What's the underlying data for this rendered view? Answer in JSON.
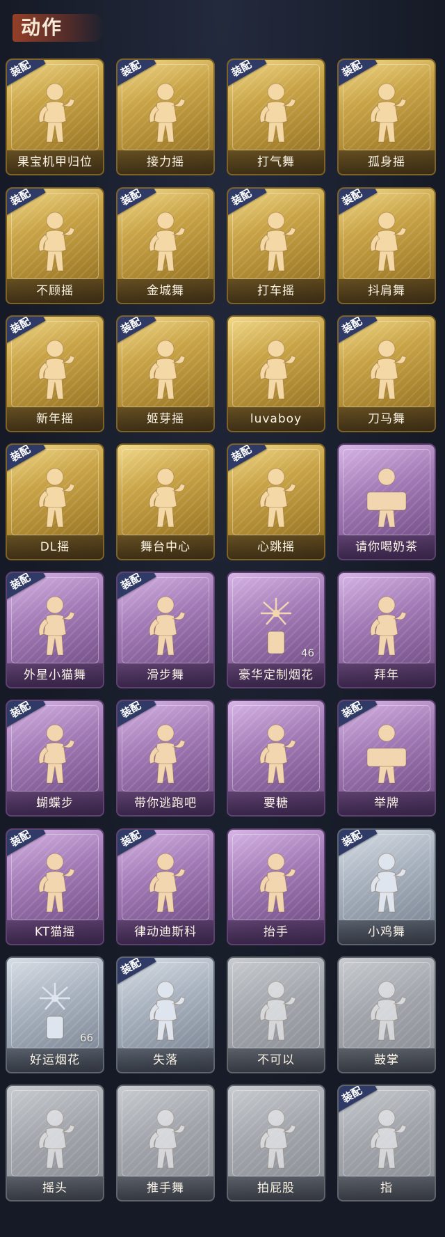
{
  "header": {
    "title": "动作"
  },
  "badge_label": "装配",
  "cards": [
    {
      "label": "果宝机甲归位",
      "tier": "gold",
      "equipped": true,
      "count": "",
      "icon": "dance-pose-icon"
    },
    {
      "label": "接力摇",
      "tier": "gold",
      "equipped": true,
      "count": "",
      "icon": "dance-pose-icon"
    },
    {
      "label": "打气舞",
      "tier": "gold",
      "equipped": true,
      "count": "",
      "icon": "dance-pose-icon"
    },
    {
      "label": "孤身摇",
      "tier": "gold",
      "equipped": true,
      "count": "",
      "icon": "dance-pose-icon"
    },
    {
      "label": "不顾摇",
      "tier": "gold",
      "equipped": true,
      "count": "",
      "icon": "dance-pose-icon"
    },
    {
      "label": "金城舞",
      "tier": "gold",
      "equipped": true,
      "count": "",
      "icon": "dance-pose-icon"
    },
    {
      "label": "打车摇",
      "tier": "gold",
      "equipped": true,
      "count": "",
      "icon": "dance-pose-icon"
    },
    {
      "label": "抖肩舞",
      "tier": "gold",
      "equipped": true,
      "count": "",
      "icon": "dance-pose-icon"
    },
    {
      "label": "新年摇",
      "tier": "gold",
      "equipped": true,
      "count": "",
      "icon": "dance-pose-icon"
    },
    {
      "label": "姬芽摇",
      "tier": "gold",
      "equipped": true,
      "count": "",
      "icon": "dance-pose-icon"
    },
    {
      "label": "luvaboy",
      "tier": "gold",
      "equipped": false,
      "count": "",
      "icon": "dance-pose-icon"
    },
    {
      "label": "刀马舞",
      "tier": "gold",
      "equipped": true,
      "count": "",
      "icon": "dance-pose-icon"
    },
    {
      "label": "DL摇",
      "tier": "gold",
      "equipped": true,
      "count": "",
      "icon": "dance-pose-icon"
    },
    {
      "label": "舞台中心",
      "tier": "gold",
      "equipped": false,
      "count": "",
      "icon": "dance-pose-icon"
    },
    {
      "label": "心跳摇",
      "tier": "gold",
      "equipped": true,
      "count": "",
      "icon": "dance-pose-icon"
    },
    {
      "label": "请你喝奶茶",
      "tier": "purple",
      "equipped": false,
      "count": "",
      "icon": "sign-pose-icon"
    },
    {
      "label": "外星小猫舞",
      "tier": "purple",
      "equipped": true,
      "count": "",
      "icon": "dance-pose-icon"
    },
    {
      "label": "滑步舞",
      "tier": "purple",
      "equipped": true,
      "count": "",
      "icon": "dance-pose-icon"
    },
    {
      "label": "豪华定制烟花",
      "tier": "purple",
      "equipped": false,
      "count": "46",
      "icon": "fireworks-icon"
    },
    {
      "label": "拜年",
      "tier": "purple",
      "equipped": false,
      "count": "",
      "icon": "bow-pose-icon"
    },
    {
      "label": "蝴蝶步",
      "tier": "purple",
      "equipped": true,
      "count": "",
      "icon": "dance-pose-icon"
    },
    {
      "label": "带你逃跑吧",
      "tier": "purple",
      "equipped": true,
      "count": "",
      "icon": "dance-pose-icon"
    },
    {
      "label": "要糖",
      "tier": "purple",
      "equipped": false,
      "count": "",
      "icon": "dance-pose-icon"
    },
    {
      "label": "举牌",
      "tier": "purple",
      "equipped": true,
      "count": "",
      "icon": "sign-pose-icon"
    },
    {
      "label": "KT猫摇",
      "tier": "purple",
      "equipped": true,
      "count": "",
      "icon": "dance-pose-icon"
    },
    {
      "label": "律动迪斯科",
      "tier": "purple",
      "equipped": true,
      "count": "",
      "icon": "dance-pose-icon"
    },
    {
      "label": "抬手",
      "tier": "purple",
      "equipped": false,
      "count": "",
      "icon": "dance-pose-icon"
    },
    {
      "label": "小鸡舞",
      "tier": "silver",
      "equipped": true,
      "count": "",
      "icon": "dance-pose-icon"
    },
    {
      "label": "好运烟花",
      "tier": "silver",
      "equipped": false,
      "count": "66",
      "icon": "firework-can-icon"
    },
    {
      "label": "失落",
      "tier": "silver",
      "equipped": true,
      "count": "",
      "icon": "crawl-pose-icon"
    },
    {
      "label": "不可以",
      "tier": "grey",
      "equipped": false,
      "count": "",
      "icon": "finger-wag-icon"
    },
    {
      "label": "鼓掌",
      "tier": "grey",
      "equipped": false,
      "count": "",
      "icon": "clap-hands-icon"
    },
    {
      "label": "摇头",
      "tier": "grey",
      "equipped": false,
      "count": "",
      "icon": "dance-pose-icon"
    },
    {
      "label": "推手舞",
      "tier": "grey",
      "equipped": false,
      "count": "",
      "icon": "dance-pose-icon"
    },
    {
      "label": "拍屁股",
      "tier": "grey",
      "equipped": false,
      "count": "",
      "icon": "dance-pose-icon"
    },
    {
      "label": "指",
      "tier": "grey",
      "equipped": true,
      "count": "",
      "icon": "point-hand-icon"
    }
  ]
}
